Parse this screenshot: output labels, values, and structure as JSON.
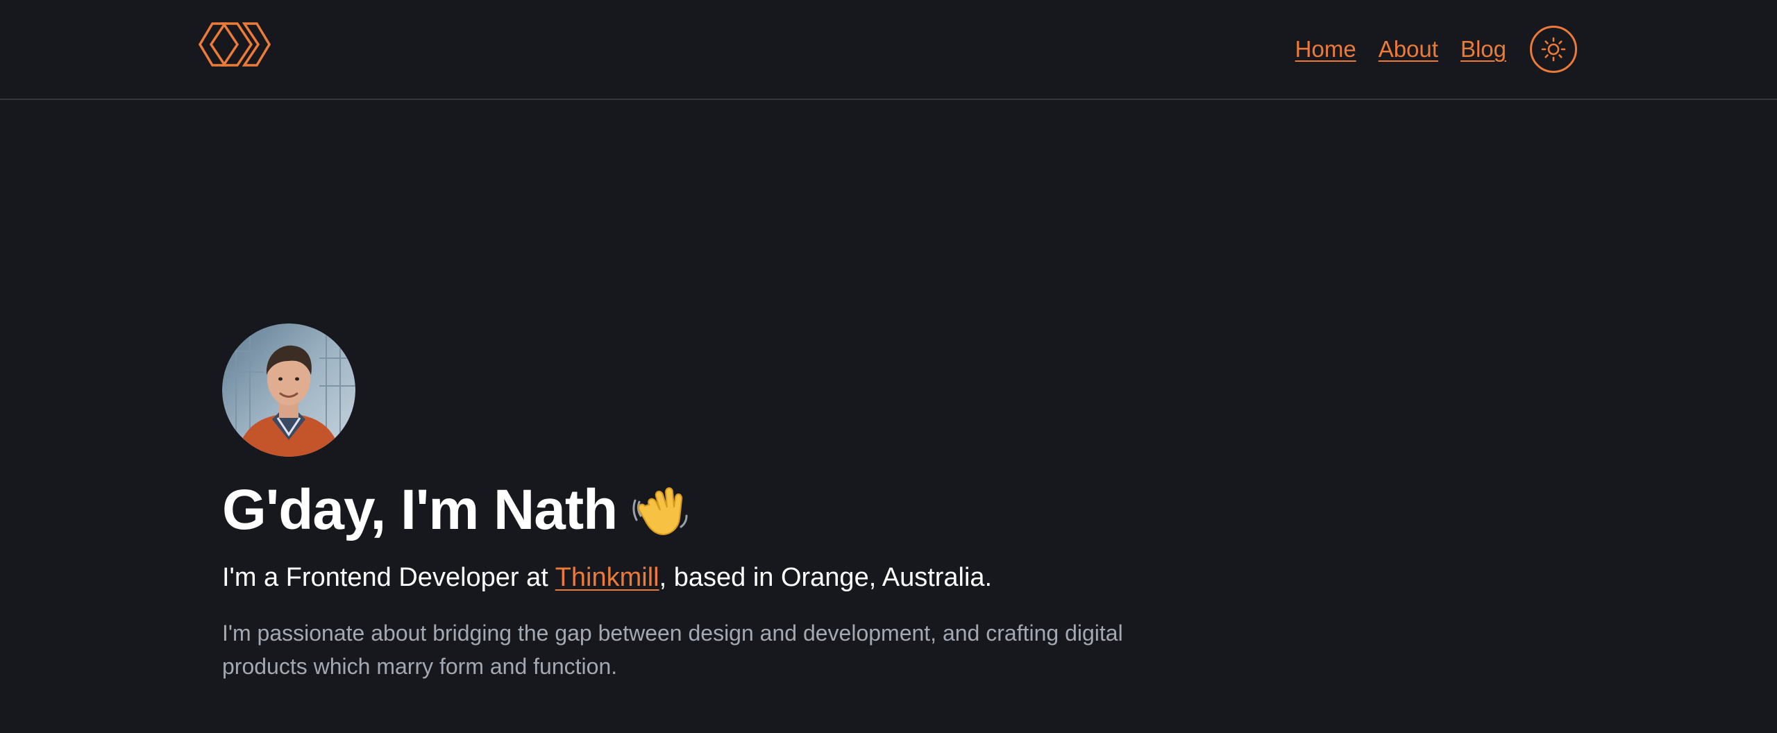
{
  "header": {
    "logo_icon": "chevron-logo-icon",
    "nav": [
      {
        "label": "Home"
      },
      {
        "label": "About"
      },
      {
        "label": "Blog"
      }
    ],
    "theme_toggle_icon": "sun-icon"
  },
  "hero": {
    "avatar_icon": "profile-photo",
    "title": "G'day, I'm Nath",
    "title_emoji": "waving-hand",
    "subtitle_prefix": "I'm a Frontend Developer at ",
    "subtitle_link": "Thinkmill",
    "subtitle_suffix": ", based in Orange, Australia.",
    "description": "I'm passionate about bridging the gap between design and development, and crafting digital products which marry form and function."
  },
  "colors": {
    "background": "#16181d",
    "accent": "#ec7a38",
    "text": "#ffffff",
    "muted": "#a4a8b1",
    "divider": "#34373e"
  }
}
